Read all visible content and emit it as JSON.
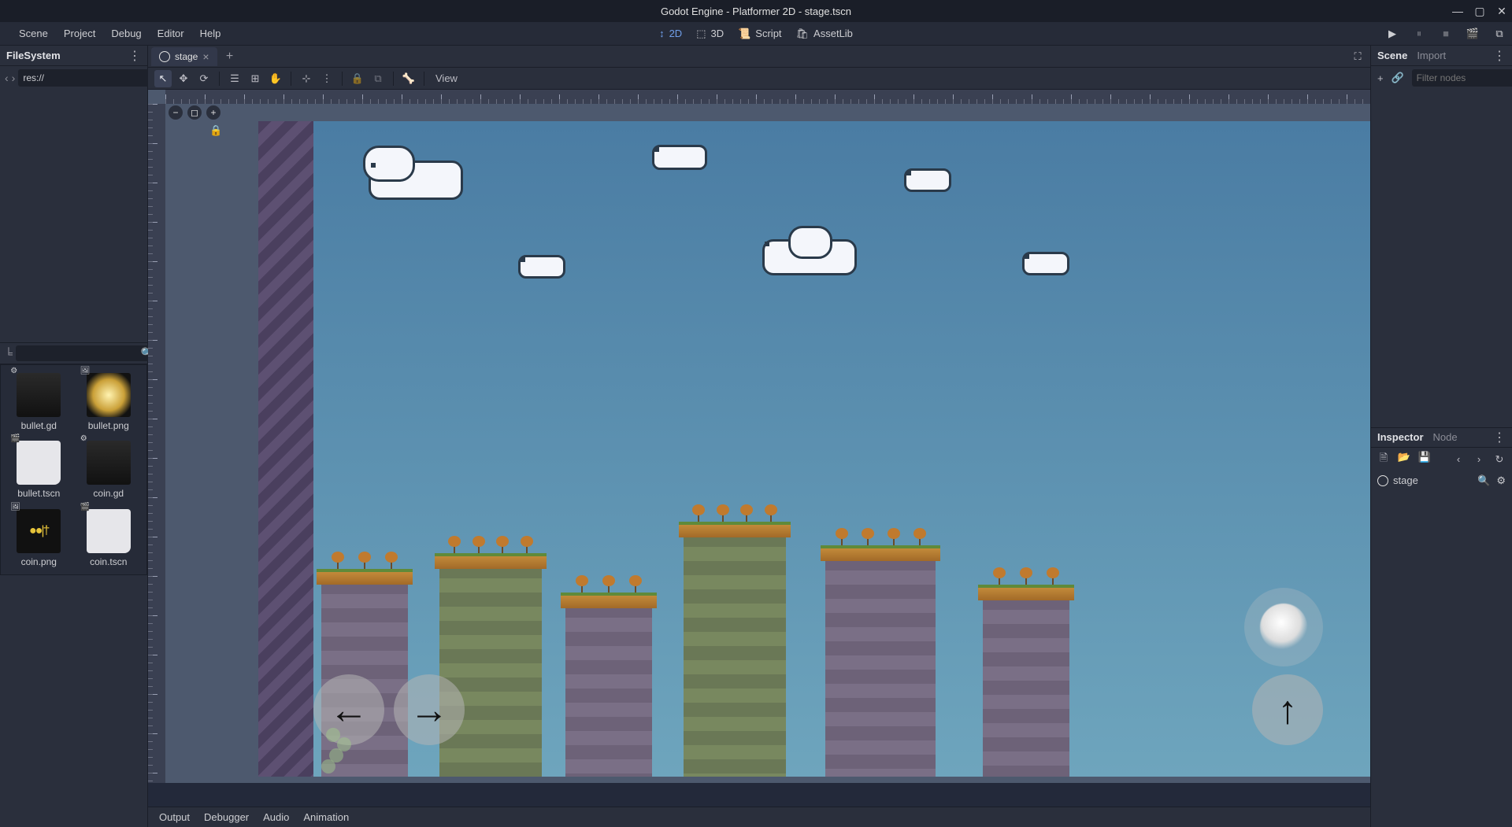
{
  "window": {
    "title": "Godot Engine - Platformer 2D - stage.tscn"
  },
  "menu": {
    "scene": "Scene",
    "project": "Project",
    "debug": "Debug",
    "editor": "Editor",
    "help": "Help"
  },
  "workspaces": {
    "two_d": "2D",
    "three_d": "3D",
    "script": "Script",
    "assetlib": "AssetLib"
  },
  "filesystem": {
    "title": "FileSystem",
    "path": "res://",
    "files": [
      {
        "name": "bullet.gd"
      },
      {
        "name": "bullet.png"
      },
      {
        "name": "bullet.tscn"
      },
      {
        "name": "coin.gd"
      },
      {
        "name": "coin.png"
      },
      {
        "name": "coin.tscn"
      }
    ]
  },
  "scene_dock": {
    "scene_tab": "Scene",
    "import_tab": "Import",
    "filter_placeholder": "Filter nodes"
  },
  "inspector": {
    "inspector_tab": "Inspector",
    "node_tab": "Node",
    "current": "stage"
  },
  "editor": {
    "open_tab": "stage",
    "view_menu": "View"
  },
  "bottom": {
    "output": "Output",
    "debugger": "Debugger",
    "audio": "Audio",
    "animation": "Animation"
  }
}
